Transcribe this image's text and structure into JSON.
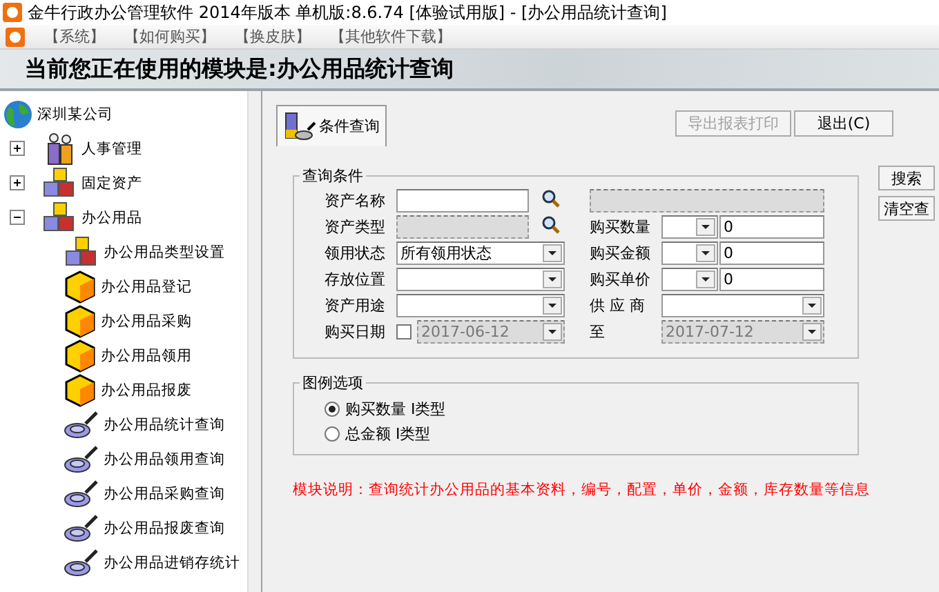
{
  "window": {
    "title": "金牛行政办公管理软件 2014年版本 单机版:8.6.74 [体验试用版] - [办公用品统计查询]"
  },
  "menu": [
    "【系统】",
    "【如何购买】",
    "【换皮肤】",
    "【其他软件下载】"
  ],
  "banner": "当前您正在使用的模块是:办公用品统计查询",
  "tree": {
    "label": "深圳某公司",
    "kind": "globe",
    "children": [
      {
        "label": "人事管理",
        "kind": "people",
        "expanded": false
      },
      {
        "label": "固定资产",
        "kind": "blocks",
        "expanded": false
      },
      {
        "label": "办公用品",
        "kind": "blocks",
        "expanded": true,
        "children": [
          {
            "label": "办公用品类型设置",
            "kind": "blocks"
          },
          {
            "label": "办公用品登记",
            "kind": "cube"
          },
          {
            "label": "办公用品采购",
            "kind": "cube"
          },
          {
            "label": "办公用品领用",
            "kind": "cube"
          },
          {
            "label": "办公用品报废",
            "kind": "cube"
          },
          {
            "label": "办公用品统计查询",
            "kind": "magnifier"
          },
          {
            "label": "办公用品领用查询",
            "kind": "magnifier"
          },
          {
            "label": "办公用品采购查询",
            "kind": "magnifier"
          },
          {
            "label": "办公用品报废查询",
            "kind": "magnifier"
          },
          {
            "label": "办公用品进销存统计",
            "kind": "magnifier"
          }
        ]
      }
    ]
  },
  "tabs": [
    {
      "label": "条件查询",
      "selected": true
    }
  ],
  "toolbar": [
    {
      "label": "导出报表打印",
      "disabled": true
    },
    {
      "label": "退出(C)",
      "disabled": false
    }
  ],
  "query": {
    "title": "查询条件",
    "rows": [
      {
        "left": {
          "label": "资产名称",
          "kind": "lookup",
          "disabled": false
        },
        "right": {
          "kind": "display"
        }
      },
      {
        "left": {
          "label": "资产类型",
          "kind": "lookup",
          "disabled": true
        },
        "right": {
          "label": "购买数量",
          "kind": "compare",
          "value": "0"
        }
      },
      {
        "left": {
          "label": "领用状态",
          "kind": "select",
          "value": "所有领用状态"
        },
        "right": {
          "label": "购买金额",
          "kind": "compare",
          "value": "0"
        }
      },
      {
        "left": {
          "label": "存放位置",
          "kind": "select"
        },
        "right": {
          "label": "购买单价",
          "kind": "compare",
          "value": "0"
        }
      },
      {
        "left": {
          "label": "资产用途",
          "kind": "select"
        },
        "right": {
          "label": "供 应 商",
          "kind": "select"
        }
      },
      {
        "left": {
          "label": "购买日期",
          "kind": "date",
          "checked": false,
          "value": "2017-06-12",
          "disabled": true
        },
        "right": {
          "label": "至",
          "kind": "date",
          "value": "2017-07-12",
          "disabled": true
        }
      }
    ]
  },
  "side_buttons": [
    "搜索",
    "清空查"
  ],
  "legend": {
    "title": "图例选项",
    "options": [
      {
        "label": "购买数量 I类型",
        "selected": true
      },
      {
        "label": "总金额 I类型",
        "selected": false
      }
    ]
  },
  "note": "模块说明：查询统计办公用品的基本资料，编号，配置，单价，金额，库存数量等信息"
}
